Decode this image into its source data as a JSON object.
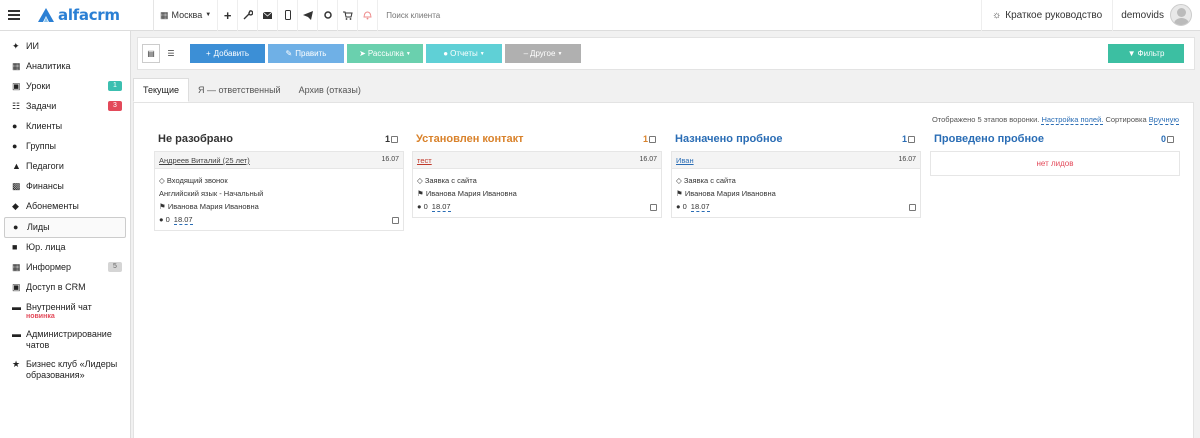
{
  "brand": {
    "name": "alfacrm",
    "color": "#2a7fd4"
  },
  "topbar": {
    "branch": "Москва",
    "icons": [
      "plus-icon",
      "wrench-icon",
      "mail-icon",
      "phone-icon",
      "telegram-icon",
      "circle-icon",
      "cart-icon",
      "bell-icon"
    ],
    "search_placeholder": "Поиск клиента",
    "guide": "Краткое руководство",
    "user": "demovids"
  },
  "sidebar": {
    "items": [
      {
        "label": "ИИ",
        "icon": "ai-icon"
      },
      {
        "label": "Аналитика",
        "icon": "analytics-icon"
      },
      {
        "label": "Уроки",
        "icon": "calendar-icon",
        "badge": "1",
        "badge_color": "#3cbfb0"
      },
      {
        "label": "Задачи",
        "icon": "tasks-icon",
        "badge": "3",
        "badge_color": "#e34a5a"
      },
      {
        "label": "Клиенты",
        "icon": "user-icon"
      },
      {
        "label": "Группы",
        "icon": "group-icon"
      },
      {
        "label": "Педагоги",
        "icon": "teacher-icon"
      },
      {
        "label": "Финансы",
        "icon": "finance-icon"
      },
      {
        "label": "Абонементы",
        "icon": "subscription-icon"
      },
      {
        "label": "Лиды",
        "icon": "leads-icon",
        "active": true
      },
      {
        "label": "Юр. лица",
        "icon": "briefcase-icon"
      },
      {
        "label": "Информер",
        "icon": "informer-icon",
        "badge": "5",
        "badge_color": "#d5d5d5"
      },
      {
        "label": "Доступ в CRM",
        "icon": "lock-icon"
      },
      {
        "label": "Внутренний чат",
        "icon": "chat-icon",
        "tag": "новинка"
      },
      {
        "label": "Администрирование чатов",
        "icon": "admin-chat-icon"
      },
      {
        "label": "Бизнес клуб «Лидеры образования»",
        "icon": "star-icon"
      }
    ]
  },
  "toolbar": {
    "add": "Добавить",
    "edit": "Править",
    "mailing": "Рассылка",
    "reports": "Отчеты",
    "other": "Другое",
    "filter": "Фильтр"
  },
  "tabs": [
    {
      "label": "Текущие",
      "active": true
    },
    {
      "label": "Я — ответственный"
    },
    {
      "label": "Архив (отказы)"
    }
  ],
  "board": {
    "info_prefix": "Отображено 5 этапов воронки.",
    "settings_link": "Настройка полей.",
    "sort_prefix": "Сортировка",
    "sort_value": "Вручную"
  },
  "stages": [
    {
      "title": "Не разобрано",
      "count": "1",
      "color": "#333333",
      "card": {
        "name": "Андреев Виталий (25 лет)",
        "date": "16.07",
        "source": "Входящий звонок",
        "course": "Английский язык - Начальный",
        "owner": "Иванова Мария Ивановна",
        "notes": "0",
        "due": "18.07"
      }
    },
    {
      "title": "Установлен контакт",
      "count": "1",
      "color": "#d9822b",
      "card": {
        "name": "тест",
        "date": "16.07",
        "source": "Заявка с сайта",
        "owner": "Иванова Мария Ивановна",
        "notes": "0",
        "due": "18.07"
      }
    },
    {
      "title": "Назначено пробное",
      "count": "1",
      "color": "#2a6db5",
      "card": {
        "name": "Иван",
        "date": "16.07",
        "source": "Заявка с сайта",
        "owner": "Иванова Мария Ивановна",
        "notes": "0",
        "due": "18.07"
      }
    },
    {
      "title": "Проведено пробное",
      "count": "0",
      "color": "#2a6db5",
      "empty": "нет лидов"
    }
  ]
}
